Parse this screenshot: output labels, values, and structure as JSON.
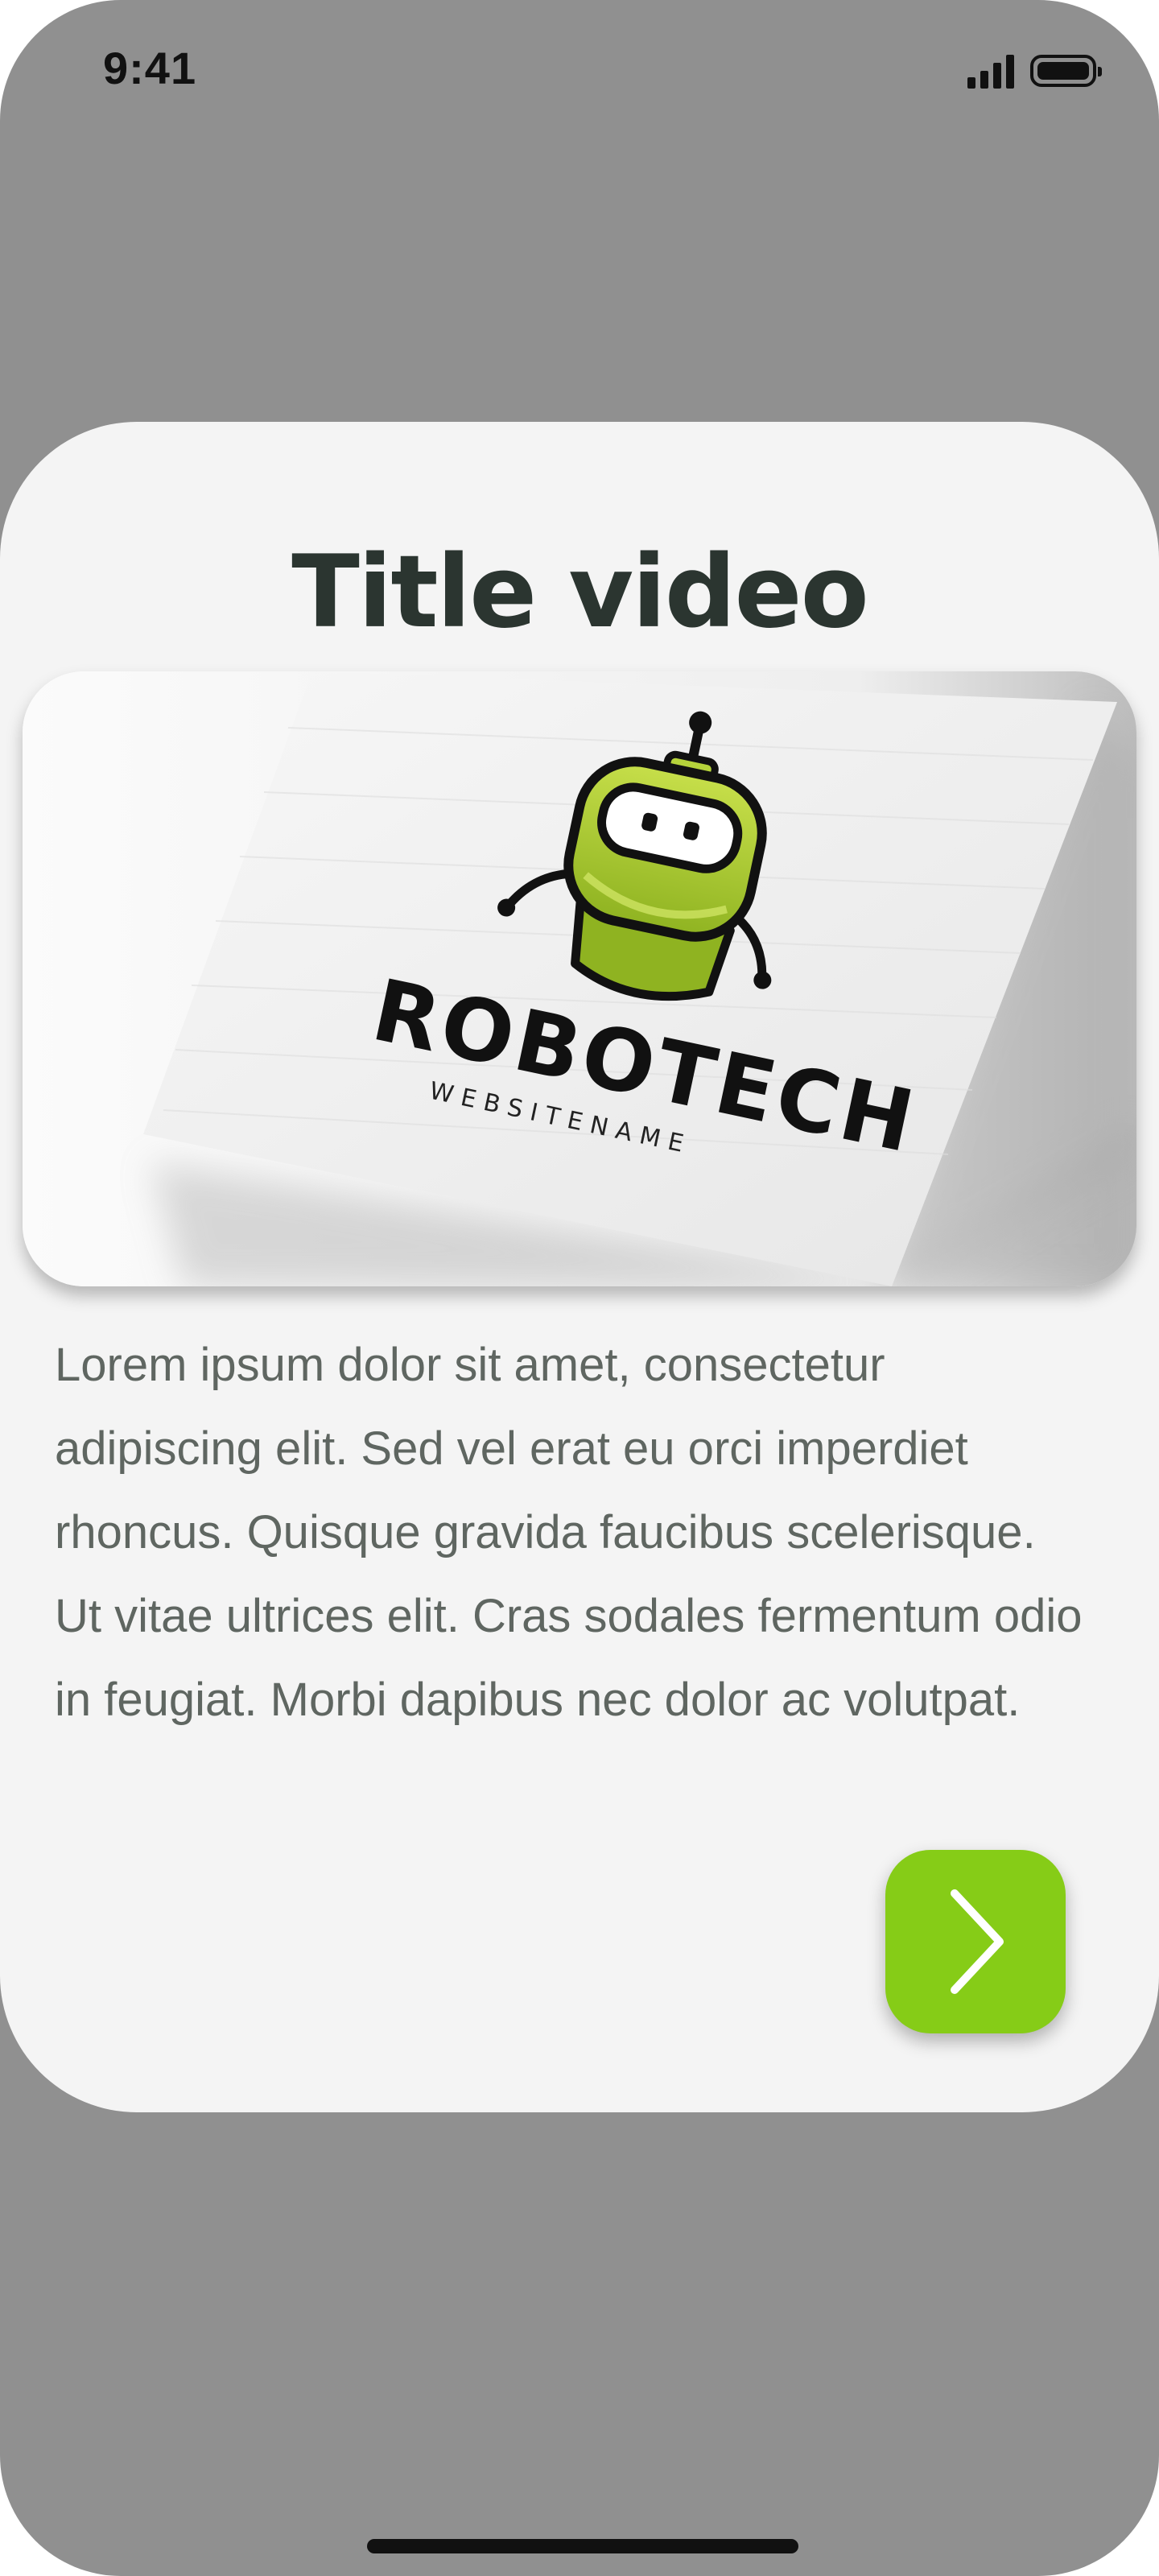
{
  "status_bar": {
    "time": "9:41",
    "signal_icon": "cellular-signal-icon",
    "battery_icon": "battery-full-icon"
  },
  "card": {
    "title": "Title video",
    "media": {
      "logo_name": "ROBOTECH",
      "logo_tagline": "WEBSITENAME",
      "logo_icon": "robot-mascot-icon"
    },
    "description": "Lorem ipsum dolor sit amet, consectetur adipiscing elit. Sed vel erat eu orci imperdiet rhoncus. Quisque gravida faucibus scelerisque. Ut vitae ultrices elit. Cras sodales fermentum odio in feugiat. Morbi dapibus nec dolor ac volutpat.",
    "next_button": {
      "icon": "chevron-right-icon"
    }
  },
  "colors": {
    "background": "#909090",
    "card": "#f4f4f4",
    "title": "#2b3530",
    "accent": "#86cc17",
    "text": "#5f6661"
  }
}
